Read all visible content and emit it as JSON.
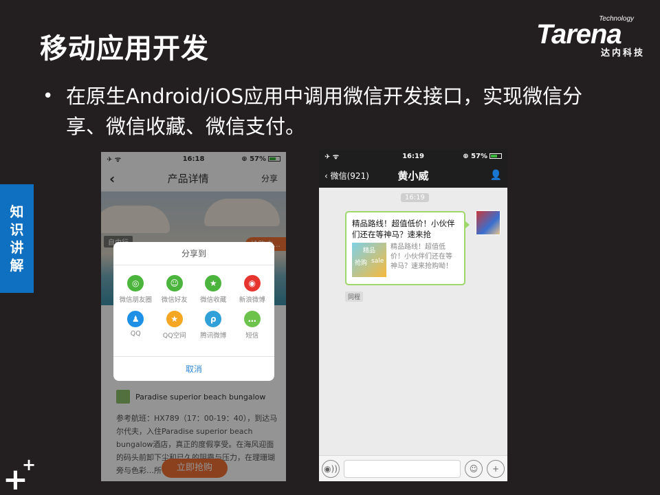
{
  "slide": {
    "title": "移动应用开发",
    "bullet": "在原生Android/iOS应用中调用微信开发接口，实现微信分享、微信收藏、微信支付。",
    "bullet_marker": "•",
    "side_tab": [
      "知",
      "识",
      "讲",
      "解"
    ],
    "accent_color": "#0f6fc0"
  },
  "logo": {
    "technology": "Technology",
    "brand": "Tarena",
    "cn": "达内科技"
  },
  "phone1": {
    "status": {
      "left": "✈ ᯤ",
      "time": "16:18",
      "right": "⊕ 57%"
    },
    "navbar": {
      "back": "‹",
      "title": "产品详情",
      "share": "分享"
    },
    "hero": {
      "tag_left": "自由行",
      "tag_right": "抢购中..."
    },
    "share_dialog": {
      "title": "分享到",
      "items": [
        {
          "label": "微信朋友圈",
          "icon": "moments-icon",
          "color": "#4bb43c",
          "glyph": "◎"
        },
        {
          "label": "微信好友",
          "icon": "wechat-icon",
          "color": "#4bb43c",
          "glyph": "☺"
        },
        {
          "label": "微信收藏",
          "icon": "favorite-icon",
          "color": "#4bb43c",
          "glyph": "★"
        },
        {
          "label": "新浪微博",
          "icon": "weibo-icon",
          "color": "#e6352e",
          "glyph": "◉"
        },
        {
          "label": "QQ",
          "icon": "qq-icon",
          "color": "#1e90e6",
          "glyph": "♟"
        },
        {
          "label": "QQ空间",
          "icon": "qzone-icon",
          "color": "#f5a623",
          "glyph": "★"
        },
        {
          "label": "腾讯微博",
          "icon": "tencent-weibo-icon",
          "color": "#2fa0d8",
          "glyph": "ρ"
        },
        {
          "label": "短信",
          "icon": "sms-icon",
          "color": "#6cc24a",
          "glyph": "…"
        }
      ],
      "cancel": "取消"
    },
    "hotel_name": "Paradise superior beach bungalow",
    "description": "参考航班：HX789（17：00-19：40），到达马尔代夫，入住Paradise superior beach bungalow酒店，真正的度假享受。在海风迎面的码头前卸下尘和已久的阴霾与压力，在理珊瑚旁与色彩…所有的梦想…",
    "buy_button": "立即抢购"
  },
  "phone2": {
    "status": {
      "left": "✈ ᯤ",
      "time": "16:19",
      "right": "⊕ 57%"
    },
    "navbar": {
      "back": "‹ 微信(921)",
      "title": "黄小威",
      "person": "👤"
    },
    "time_chip": "16:19",
    "message": {
      "title": "精品路线！超值低价！小伙伴们还在等神马？速来抢",
      "card_desc": "精品路线！超值低价！小伙伴们还在等神马？速来抢购呦！",
      "thumb_labels": [
        "精品",
        "抢购",
        "sale"
      ]
    },
    "source": "同程",
    "inputbar": {
      "voice": "◉))",
      "emoji": "☺",
      "plus": "+"
    }
  }
}
